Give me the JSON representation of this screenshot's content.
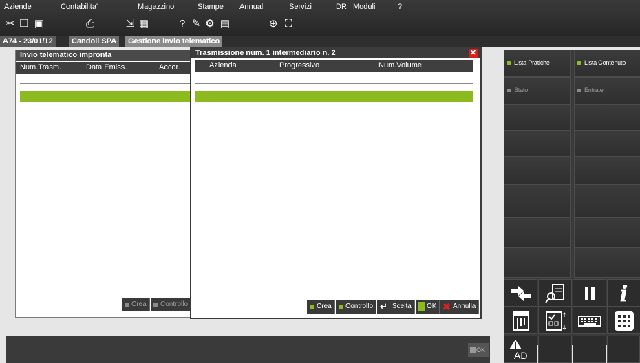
{
  "menu": {
    "items": [
      "Aziende",
      "Contabilita'",
      "Magazzino",
      "Stampe",
      "Annuali",
      "Servizi",
      "DR",
      "Moduli",
      "?"
    ]
  },
  "toolbar": {
    "icons": [
      "scissors-icon",
      "copy-icon",
      "paste-icon",
      "print-icon",
      "export-icon",
      "calendar-icon",
      "help-icon",
      "edit-icon",
      "tools-icon",
      "calculator-icon",
      "zoom-icon",
      "fullscreen-icon"
    ]
  },
  "breadcrumb": {
    "context": "A74 - 23/01/12",
    "company": "Candoli SPA",
    "function": "Gestione invio telematico"
  },
  "left_window": {
    "title": "Invio telematico impronta",
    "columns": [
      "Num.Trasm.",
      "Data Emiss.",
      "Accor."
    ],
    "buttons": [
      "Crea",
      "Controllo"
    ]
  },
  "dialog": {
    "title": "Trasmissione num.  1 intermediario n.  2",
    "columns": [
      "Azienda",
      "Progressivo",
      "Num.Volume"
    ],
    "buttons": {
      "crea": "Crea",
      "controllo": "Controllo",
      "scelta": "Scelta",
      "ok": "OK",
      "annulla": "Annulla"
    }
  },
  "right_panel": {
    "lista_pratiche": "Lista Pratiche",
    "lista_contenuto": "Lista Contenuto",
    "stato": "Stato",
    "entratel": "Entratel"
  },
  "icon_grid": {
    "ad_label": "AD"
  },
  "status": {
    "ok_label": "OK"
  },
  "colors": {
    "accent_green": "#8dba1e",
    "close_red": "#d62020",
    "dark_bg": "#3a3a3a"
  }
}
